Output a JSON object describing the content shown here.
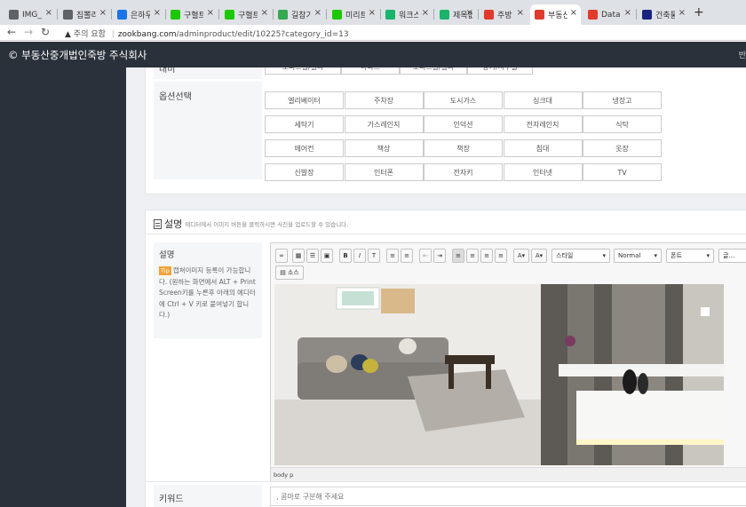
{
  "tabs": [
    {
      "label": "IMG_0",
      "icon": "globe-icon",
      "color": "#5f6368"
    },
    {
      "label": "집뽈리",
      "icon": "globe-icon",
      "color": "#5f6368"
    },
    {
      "label": "은하우",
      "icon": "zigbang-icon",
      "color": "#1a73e8"
    },
    {
      "label": "구혈트",
      "icon": "naver-icon",
      "color": "#1ec800"
    },
    {
      "label": "구혈트",
      "icon": "chat-icon",
      "color": "#1ec800"
    },
    {
      "label": "길참기",
      "icon": "google-icon",
      "color": "#34a853"
    },
    {
      "label": "미리트",
      "icon": "naver-icon",
      "color": "#1ec800"
    },
    {
      "label": "워크스",
      "icon": "m-icon",
      "color": "#19b36b"
    },
    {
      "label": "제목없",
      "icon": "m-icon",
      "color": "#19b36b"
    },
    {
      "label": "주방",
      "icon": "house-icon",
      "color": "#e03a2c"
    },
    {
      "label": "부동산",
      "icon": "house-icon",
      "color": "#e03a2c"
    },
    {
      "label": "Datab",
      "icon": "house-icon",
      "color": "#e03a2c"
    },
    {
      "label": "건축물",
      "icon": "caret-icon",
      "color": "#1a237e"
    }
  ],
  "newtab": "+",
  "address": {
    "security": "주의 요함",
    "url_domain": "zookbang.com",
    "url_path": "/adminproduct/edit/10225?category_id=13"
  },
  "brand": "© 부동산중개법인죽방 주식회사",
  "topnav_right": "반",
  "partial_row": {
    "label": "대비",
    "options": [
      "오피스텔/빌라",
      "아파트",
      "오피스텔/빌라",
      "상가/사무실"
    ]
  },
  "options": {
    "label": "옵션선택",
    "items": [
      "엘리베이터",
      "주차장",
      "도시가스",
      "싱크대",
      "냉장고",
      "세탁기",
      "가스레인지",
      "인덕션",
      "전자레인지",
      "식탁",
      "에어컨",
      "책상",
      "책장",
      "침대",
      "옷장",
      "신발장",
      "인터폰",
      "전자키",
      "인터넷",
      "TV"
    ]
  },
  "description": {
    "title": "설명",
    "hint": "에디터에서 이미지 버튼을 클릭하시면 사진을 업로드할 수 있습니다.",
    "label": "설명",
    "tip_badge": "Tip",
    "tip_text": "캡쳐이미지 등록이 가능합니다. (원하는 화면에서 ALT + Print Screen키를 누른후 아래의 에디터에 Ctrl + V 키로 붙여넣기 합니다.)"
  },
  "editor": {
    "style_label": "스타일",
    "format_label": "Normal",
    "font_label": "폰트",
    "size_label": "글...",
    "source_label": "소스",
    "status_path": "body  p"
  },
  "keyword": {
    "label": "키워드",
    "placeholder": ", 콤마로 구분해 주세요"
  }
}
